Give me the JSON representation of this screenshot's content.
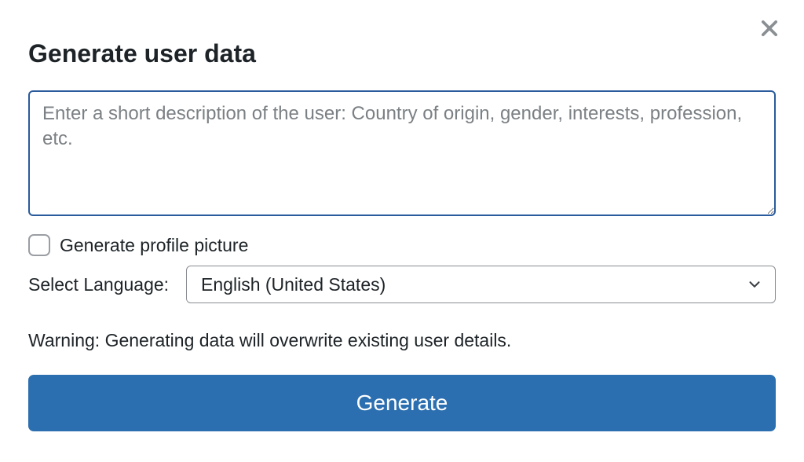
{
  "dialog": {
    "title": "Generate user data"
  },
  "form": {
    "description_placeholder": "Enter a short description of the user: Country of origin, gender, interests, profession, etc.",
    "description_value": "",
    "profile_picture_label": "Generate profile picture",
    "profile_picture_checked": false,
    "language_label": "Select Language:",
    "language_selected": "English (United States)",
    "warning": "Warning: Generating data will overwrite existing user details.",
    "submit_label": "Generate"
  }
}
